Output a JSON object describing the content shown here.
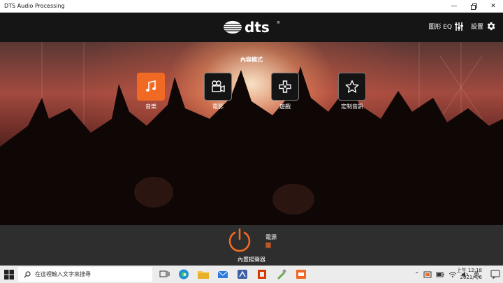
{
  "window": {
    "title": "DTS Audio Processing"
  },
  "header": {
    "logo_text": "dts",
    "graphic_eq_label": "圖形 EQ",
    "settings_label": "設置"
  },
  "content_modes": {
    "title": "內容模式",
    "items": [
      {
        "label": "音樂",
        "icon": "music-note-icon",
        "active": true
      },
      {
        "label": "電影",
        "icon": "movie-camera-icon",
        "active": false
      },
      {
        "label": "遊戲",
        "icon": "gamepad-icon",
        "active": false
      },
      {
        "label": "定制音訊",
        "icon": "star-icon",
        "active": false
      }
    ]
  },
  "power": {
    "label": "電源",
    "state": "開",
    "speaker_label": "內置揚聲器"
  },
  "taskbar": {
    "search_placeholder": "在這裡輸入文字來搜尋",
    "ime_label": "英",
    "time": "上午 12:18",
    "date": "2021/4/6"
  },
  "colors": {
    "accent": "#f16a24",
    "header_bg": "#151515",
    "bottom_bg": "#2e2e2e"
  }
}
